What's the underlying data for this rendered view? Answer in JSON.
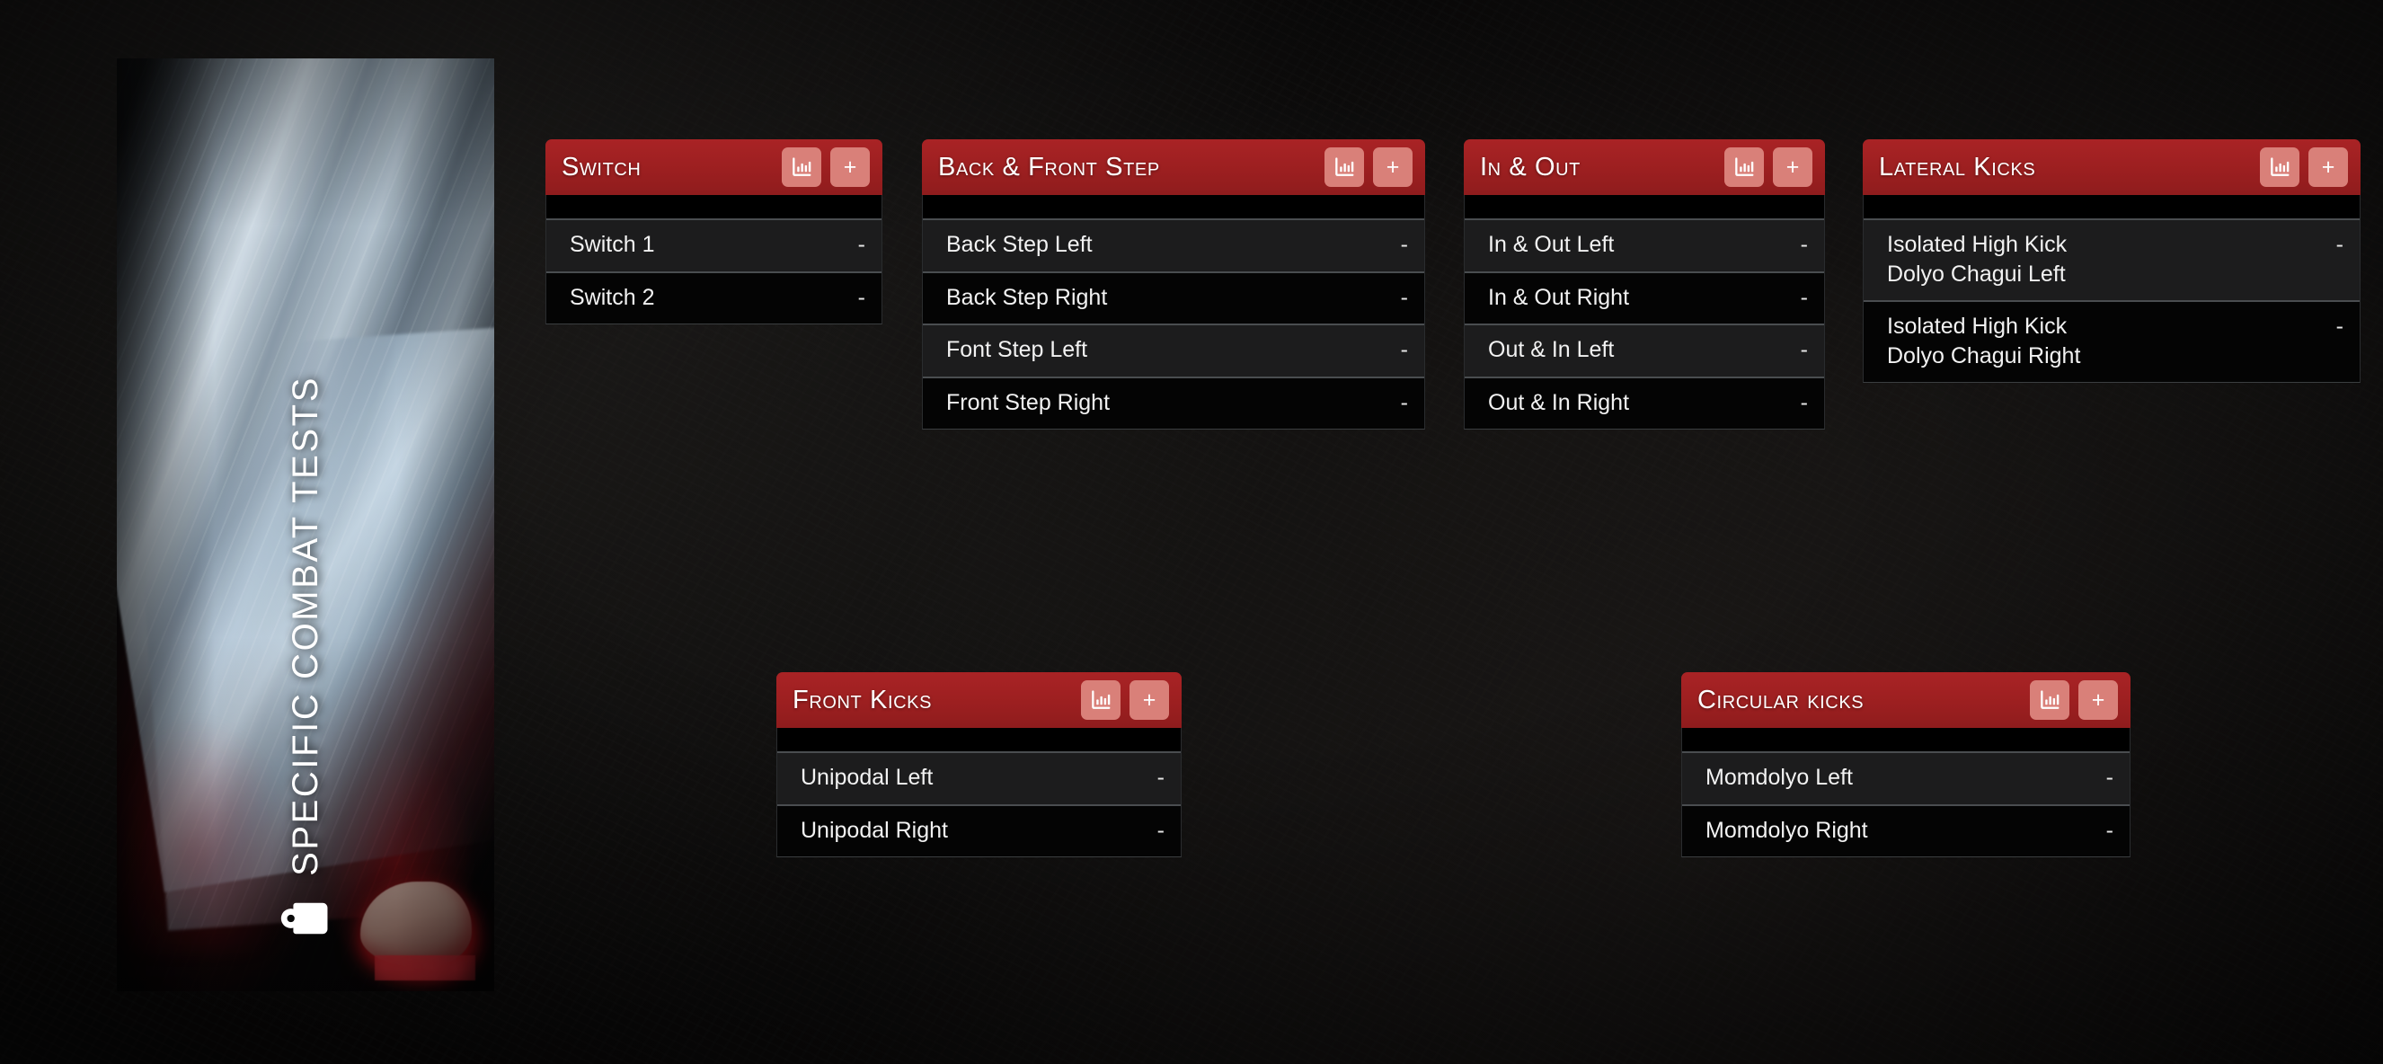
{
  "theme": {
    "page_bg": "#0b0a0a",
    "header_red": "#9c1f20",
    "button_rose": "#d98079",
    "row_odd_bg": "#1c1c1d",
    "row_even_bg": "#040404",
    "row_divider": "#4a4d50",
    "text_primary": "#f2f2f2"
  },
  "hero": {
    "title": "Specific Combat Tests",
    "icon": "tag-icon"
  },
  "header_actions": {
    "chart_icon": "bar-chart-icon",
    "add_icon": "plus-icon",
    "add_label": "+"
  },
  "cards": [
    {
      "id": "switch",
      "title": "Switch",
      "rows": [
        {
          "label": "Switch 1",
          "value": "-"
        },
        {
          "label": "Switch 2",
          "value": "-"
        }
      ]
    },
    {
      "id": "back-front-step",
      "title": "Back & Front Step",
      "rows": [
        {
          "label": "Back Step Left",
          "value": "-"
        },
        {
          "label": "Back Step Right",
          "value": "-"
        },
        {
          "label": "Font Step Left",
          "value": "-"
        },
        {
          "label": "Front Step Right",
          "value": "-"
        }
      ]
    },
    {
      "id": "in-out",
      "title": "In & Out",
      "rows": [
        {
          "label": "In & Out Left",
          "value": "-"
        },
        {
          "label": "In & Out Right",
          "value": "-"
        },
        {
          "label": "Out & In Left",
          "value": "-"
        },
        {
          "label": "Out & In Right",
          "value": "-"
        }
      ]
    },
    {
      "id": "lateral-kicks",
      "title": "Lateral Kicks",
      "rows": [
        {
          "label": "Isolated High Kick\nDolyo Chagui Left",
          "value": "-"
        },
        {
          "label": "Isolated High Kick\nDolyo Chagui Right",
          "value": "-"
        }
      ]
    },
    {
      "id": "front-kicks",
      "title": "Front Kicks",
      "rows": [
        {
          "label": "Unipodal Left",
          "value": "-"
        },
        {
          "label": "Unipodal Right",
          "value": "-"
        }
      ]
    },
    {
      "id": "circular-kicks",
      "title": "Circular kicks",
      "rows": [
        {
          "label": "Momdolyo Left",
          "value": "-"
        },
        {
          "label": "Momdolyo Right",
          "value": "-"
        }
      ]
    }
  ]
}
